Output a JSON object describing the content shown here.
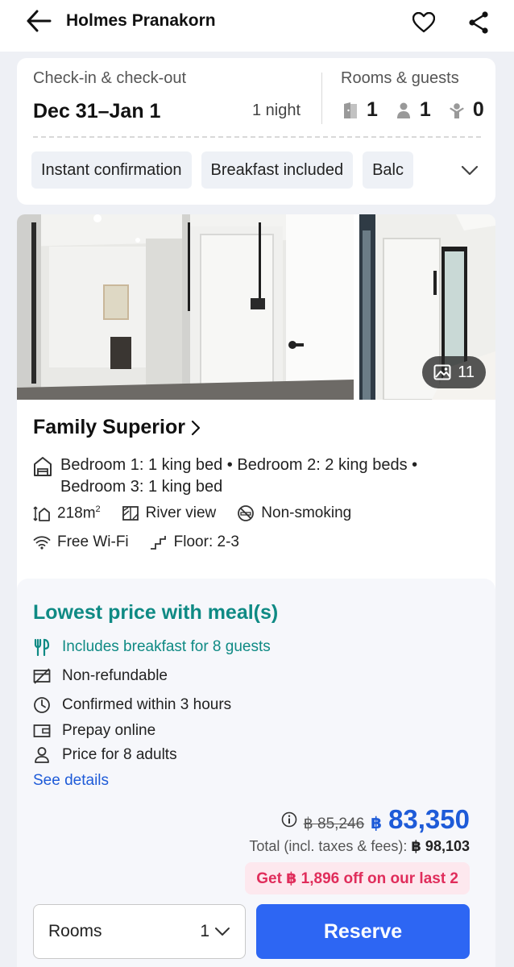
{
  "header": {
    "title": "Holmes Pranakorn",
    "back_icon": "arrow-left-icon",
    "favorite_icon": "heart-outline-icon",
    "share_icon": "share-icon"
  },
  "search": {
    "checkin_label": "Check-in & check-out",
    "dates": "Dec 31–Jan 1",
    "nights": "1 night",
    "rooms_guests_label": "Rooms & guests",
    "rooms": "1",
    "adults": "1",
    "children": "0",
    "filters": [
      "Instant confirmation",
      "Breakfast included",
      "Balc"
    ]
  },
  "room": {
    "photo_count": "11",
    "name": "Family Superior",
    "beds": "Bedroom 1: 1 king bed • Bedroom 2: 2 king beds • Bedroom 3: 1 king bed",
    "size_value": "218m",
    "size_sup": "2",
    "view": "River view",
    "smoking": "Non-smoking",
    "wifi": "Free Wi-Fi",
    "floor": "Floor: 2-3"
  },
  "offer": {
    "title": "Lowest price with meal(s)",
    "breakfast": "Includes breakfast for 8 guests",
    "refund": "Non-refundable",
    "confirm": "Confirmed within 3 hours",
    "payment": "Prepay online",
    "occupancy": "Price for 8 adults",
    "see_details": "See details",
    "price_old": "฿ 85,246",
    "currency": "฿",
    "price_new": "83,350",
    "total_label": "Total (incl. taxes & fees):",
    "total_value": "฿ 98,103",
    "promo": "Get ฿ 1,896 off on our last 2",
    "rooms_label": "Rooms",
    "rooms_qty": "1",
    "reserve_label": "Reserve"
  },
  "colors": {
    "accent_blue": "#2d66f3",
    "teal": "#0f8a84",
    "promo_red": "#e02d5b"
  }
}
